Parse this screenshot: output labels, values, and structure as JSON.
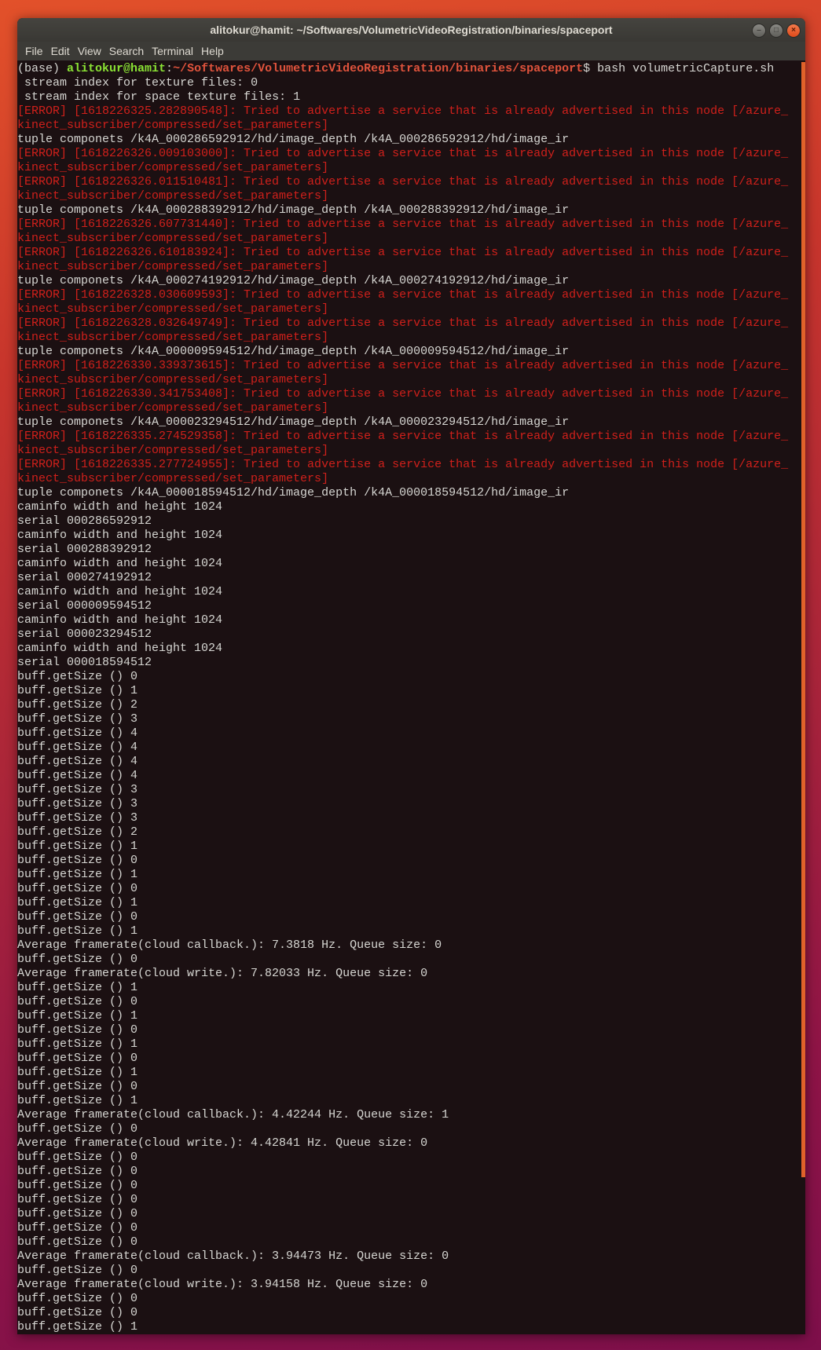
{
  "window": {
    "title": "alitokur@hamit: ~/Softwares/VolumetricVideoRegistration/binaries/spaceport",
    "buttons": {
      "minimize": "–",
      "maximize": "□",
      "close": "×"
    }
  },
  "menu": [
    "File",
    "Edit",
    "View",
    "Search",
    "Terminal",
    "Help"
  ],
  "prompt": {
    "env": "(base) ",
    "user_host": "alitokur@hamit",
    "sep": ":",
    "path": "~/Softwares/VolumetricVideoRegistration/binaries/spaceport",
    "command": "$ bash volumetricCapture.sh"
  },
  "colors": {
    "error": "#d0201b",
    "prompt_user": "#8ae234",
    "prompt_path": "#e0533c",
    "text": "#d6d6d2"
  },
  "lines": [
    {
      "t": "n",
      "text": " stream index for texture files: 0"
    },
    {
      "t": "n",
      "text": " stream index for space texture files: 1"
    },
    {
      "t": "e",
      "text": "[ERROR] [1618226325.282890548]: Tried to advertise a service that is already advertised in this node [/azure_kinect_subscriber/compressed/set_parameters]"
    },
    {
      "t": "n",
      "text": "tuple componets /k4A_000286592912/hd/image_depth /k4A_000286592912/hd/image_ir"
    },
    {
      "t": "e",
      "text": "[ERROR] [1618226326.009103000]: Tried to advertise a service that is already advertised in this node [/azure_kinect_subscriber/compressed/set_parameters]"
    },
    {
      "t": "e",
      "text": "[ERROR] [1618226326.011510481]: Tried to advertise a service that is already advertised in this node [/azure_kinect_subscriber/compressed/set_parameters]"
    },
    {
      "t": "n",
      "text": "tuple componets /k4A_000288392912/hd/image_depth /k4A_000288392912/hd/image_ir"
    },
    {
      "t": "e",
      "text": "[ERROR] [1618226326.607731440]: Tried to advertise a service that is already advertised in this node [/azure_kinect_subscriber/compressed/set_parameters]"
    },
    {
      "t": "e",
      "text": "[ERROR] [1618226326.610183924]: Tried to advertise a service that is already advertised in this node [/azure_kinect_subscriber/compressed/set_parameters]"
    },
    {
      "t": "n",
      "text": "tuple componets /k4A_000274192912/hd/image_depth /k4A_000274192912/hd/image_ir"
    },
    {
      "t": "e",
      "text": "[ERROR] [1618226328.030609593]: Tried to advertise a service that is already advertised in this node [/azure_kinect_subscriber/compressed/set_parameters]"
    },
    {
      "t": "e",
      "text": "[ERROR] [1618226328.032649749]: Tried to advertise a service that is already advertised in this node [/azure_kinect_subscriber/compressed/set_parameters]"
    },
    {
      "t": "n",
      "text": "tuple componets /k4A_000009594512/hd/image_depth /k4A_000009594512/hd/image_ir"
    },
    {
      "t": "e",
      "text": "[ERROR] [1618226330.339373615]: Tried to advertise a service that is already advertised in this node [/azure_kinect_subscriber/compressed/set_parameters]"
    },
    {
      "t": "e",
      "text": "[ERROR] [1618226330.341753408]: Tried to advertise a service that is already advertised in this node [/azure_kinect_subscriber/compressed/set_parameters]"
    },
    {
      "t": "n",
      "text": "tuple componets /k4A_000023294512/hd/image_depth /k4A_000023294512/hd/image_ir"
    },
    {
      "t": "e",
      "text": "[ERROR] [1618226335.274529358]: Tried to advertise a service that is already advertised in this node [/azure_kinect_subscriber/compressed/set_parameters]"
    },
    {
      "t": "e",
      "text": "[ERROR] [1618226335.277724955]: Tried to advertise a service that is already advertised in this node [/azure_kinect_subscriber/compressed/set_parameters]"
    },
    {
      "t": "n",
      "text": "tuple componets /k4A_000018594512/hd/image_depth /k4A_000018594512/hd/image_ir"
    },
    {
      "t": "n",
      "text": "caminfo width and height 1024"
    },
    {
      "t": "n",
      "text": "serial 000286592912"
    },
    {
      "t": "n",
      "text": "caminfo width and height 1024"
    },
    {
      "t": "n",
      "text": "serial 000288392912"
    },
    {
      "t": "n",
      "text": "caminfo width and height 1024"
    },
    {
      "t": "n",
      "text": "serial 000274192912"
    },
    {
      "t": "n",
      "text": "caminfo width and height 1024"
    },
    {
      "t": "n",
      "text": "serial 000009594512"
    },
    {
      "t": "n",
      "text": "caminfo width and height 1024"
    },
    {
      "t": "n",
      "text": "serial 000023294512"
    },
    {
      "t": "n",
      "text": "caminfo width and height 1024"
    },
    {
      "t": "n",
      "text": "serial 000018594512"
    },
    {
      "t": "n",
      "text": "buff.getSize () 0"
    },
    {
      "t": "n",
      "text": "buff.getSize () 1"
    },
    {
      "t": "n",
      "text": "buff.getSize () 2"
    },
    {
      "t": "n",
      "text": "buff.getSize () 3"
    },
    {
      "t": "n",
      "text": "buff.getSize () 4"
    },
    {
      "t": "n",
      "text": "buff.getSize () 4"
    },
    {
      "t": "n",
      "text": "buff.getSize () 4"
    },
    {
      "t": "n",
      "text": "buff.getSize () 4"
    },
    {
      "t": "n",
      "text": "buff.getSize () 3"
    },
    {
      "t": "n",
      "text": "buff.getSize () 3"
    },
    {
      "t": "n",
      "text": "buff.getSize () 3"
    },
    {
      "t": "n",
      "text": "buff.getSize () 2"
    },
    {
      "t": "n",
      "text": "buff.getSize () 1"
    },
    {
      "t": "n",
      "text": "buff.getSize () 0"
    },
    {
      "t": "n",
      "text": "buff.getSize () 1"
    },
    {
      "t": "n",
      "text": "buff.getSize () 0"
    },
    {
      "t": "n",
      "text": "buff.getSize () 1"
    },
    {
      "t": "n",
      "text": "buff.getSize () 0"
    },
    {
      "t": "n",
      "text": "buff.getSize () 1"
    },
    {
      "t": "n",
      "text": "Average framerate(cloud callback.): 7.3818 Hz. Queue size: 0"
    },
    {
      "t": "n",
      "text": "buff.getSize () 0"
    },
    {
      "t": "n",
      "text": "Average framerate(cloud write.): 7.82033 Hz. Queue size: 0"
    },
    {
      "t": "n",
      "text": "buff.getSize () 1"
    },
    {
      "t": "n",
      "text": "buff.getSize () 0"
    },
    {
      "t": "n",
      "text": "buff.getSize () 1"
    },
    {
      "t": "n",
      "text": "buff.getSize () 0"
    },
    {
      "t": "n",
      "text": "buff.getSize () 1"
    },
    {
      "t": "n",
      "text": "buff.getSize () 0"
    },
    {
      "t": "n",
      "text": "buff.getSize () 1"
    },
    {
      "t": "n",
      "text": "buff.getSize () 0"
    },
    {
      "t": "n",
      "text": "buff.getSize () 1"
    },
    {
      "t": "n",
      "text": "Average framerate(cloud callback.): 4.42244 Hz. Queue size: 1"
    },
    {
      "t": "n",
      "text": "buff.getSize () 0"
    },
    {
      "t": "n",
      "text": "Average framerate(cloud write.): 4.42841 Hz. Queue size: 0"
    },
    {
      "t": "n",
      "text": "buff.getSize () 0"
    },
    {
      "t": "n",
      "text": "buff.getSize () 0"
    },
    {
      "t": "n",
      "text": "buff.getSize () 0"
    },
    {
      "t": "n",
      "text": "buff.getSize () 0"
    },
    {
      "t": "n",
      "text": "buff.getSize () 0"
    },
    {
      "t": "n",
      "text": "buff.getSize () 0"
    },
    {
      "t": "n",
      "text": "buff.getSize () 0"
    },
    {
      "t": "n",
      "text": "Average framerate(cloud callback.): 3.94473 Hz. Queue size: 0"
    },
    {
      "t": "n",
      "text": "buff.getSize () 0"
    },
    {
      "t": "n",
      "text": "Average framerate(cloud write.): 3.94158 Hz. Queue size: 0"
    },
    {
      "t": "n",
      "text": "buff.getSize () 0"
    },
    {
      "t": "n",
      "text": "buff.getSize () 0"
    },
    {
      "t": "n",
      "text": "buff.getSize () 1"
    }
  ]
}
